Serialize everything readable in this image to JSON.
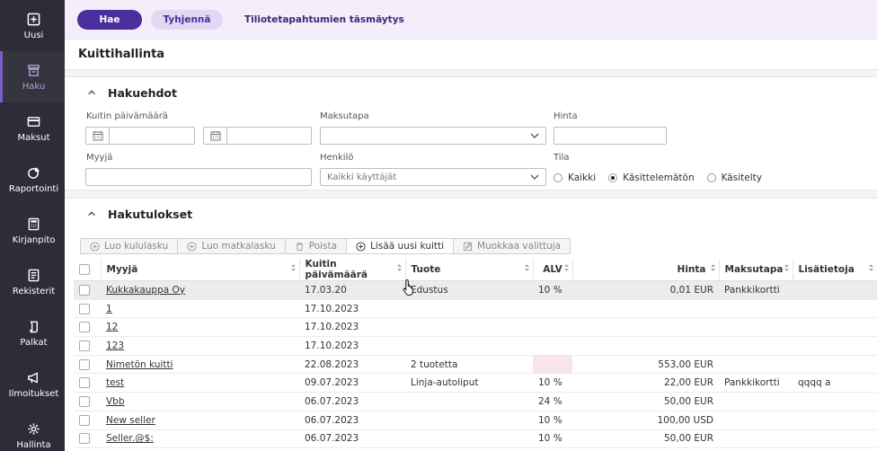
{
  "sidebar": {
    "items": [
      {
        "label": "Uusi",
        "icon": "plus-square-icon",
        "active": false
      },
      {
        "label": "Haku",
        "icon": "archive-box-icon",
        "active": true
      },
      {
        "label": "Maksut",
        "icon": "credit-card-icon",
        "active": false
      },
      {
        "label": "Raportointi",
        "icon": "pie-chart-icon",
        "active": false
      },
      {
        "label": "Kirjanpito",
        "icon": "calculator-icon",
        "active": false
      },
      {
        "label": "Rekisterit",
        "icon": "register-book-icon",
        "active": false
      },
      {
        "label": "Palkat",
        "icon": "salary-icon",
        "active": false
      },
      {
        "label": "Ilmoitukset",
        "icon": "megaphone-icon",
        "active": false
      },
      {
        "label": "Hallinta",
        "icon": "gear-icon",
        "active": false
      }
    ]
  },
  "topbar": {
    "search_label": "Hae",
    "clear_label": "Tyhjennä",
    "link_label": "Tiliotetapahtumien täsmäytys"
  },
  "page": {
    "title": "Kuittihallinta"
  },
  "filters": {
    "section_title": "Hakuehdot",
    "date_label": "Kuitin päivämäärä",
    "payment_label": "Maksutapa",
    "price_label": "Hinta",
    "seller_label": "Myyjä",
    "person_label": "Henkilö",
    "person_value": "Kaikki käyttäjät",
    "state_label": "Tila",
    "state_options": [
      "Kaikki",
      "Käsittelemätön",
      "Käsitelty"
    ],
    "state_selected": "Käsittelemätön"
  },
  "results": {
    "section_title": "Hakutulokset",
    "toolbar": {
      "create_expense": "Luo kululasku",
      "create_travel": "Luo matkalasku",
      "delete": "Poista",
      "add_receipt": "Lisää uusi kuitti",
      "edit_selected": "Muokkaa valittuja"
    },
    "columns": {
      "seller": "Myyjä",
      "date": "Kuitin päivämäärä",
      "product": "Tuote",
      "vat": "ALV",
      "price": "Hinta",
      "payment": "Maksutapa",
      "info": "Lisätietoja"
    },
    "rows": [
      {
        "seller": "Kukkakauppa Oy",
        "date": "17.03.20",
        "product": "Edustus",
        "vat": "10 %",
        "price": "0,01 EUR",
        "payment": "Pankkikortti",
        "info": ""
      },
      {
        "seller": "1",
        "date": "17.10.2023",
        "product": "",
        "vat": "",
        "price": "",
        "payment": "",
        "info": ""
      },
      {
        "seller": "12",
        "date": "17.10.2023",
        "product": "",
        "vat": "",
        "price": "",
        "payment": "",
        "info": ""
      },
      {
        "seller": "123",
        "date": "17.10.2023",
        "product": "",
        "vat": "",
        "price": "",
        "payment": "",
        "info": ""
      },
      {
        "seller": "Nimetön kuitti",
        "date": "22.08.2023",
        "product": "2 tuotetta",
        "vat": "",
        "price": "553,00 EUR",
        "payment": "",
        "info": ""
      },
      {
        "seller": "test",
        "date": "09.07.2023",
        "product": "Linja-autoliput",
        "vat": "10 %",
        "price": "22,00 EUR",
        "payment": "Pankkikortti",
        "info": "qqqq a"
      },
      {
        "seller": "Vbb",
        "date": "06.07.2023",
        "product": "",
        "vat": "24 %",
        "price": "50,00 EUR",
        "payment": "",
        "info": ""
      },
      {
        "seller": "New seller",
        "date": "06.07.2023",
        "product": "",
        "vat": "10 %",
        "price": "100,00 USD",
        "payment": "",
        "info": ""
      },
      {
        "seller": "Seller.@$:",
        "date": "06.07.2023",
        "product": "",
        "vat": "10 %",
        "price": "50,00 EUR",
        "payment": "",
        "info": ""
      }
    ]
  },
  "colors": {
    "accent": "#4a2e9e",
    "sidebar_bg": "#2c2d38",
    "active_nav": "#b39ddb"
  }
}
